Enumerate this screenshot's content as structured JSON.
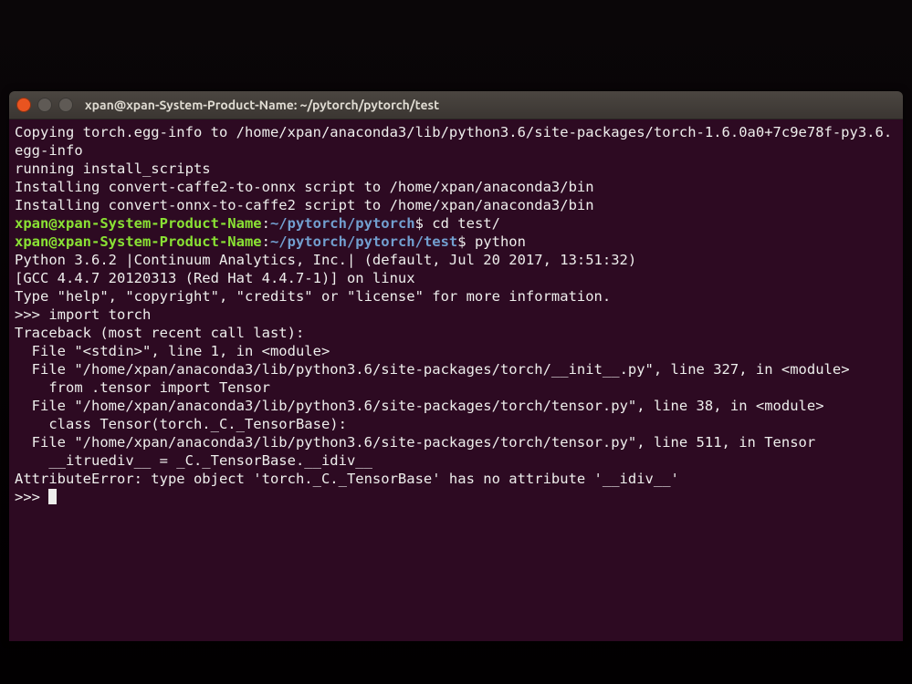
{
  "window": {
    "title": "xpan@xpan-System-Product-Name: ~/pytorch/pytorch/test"
  },
  "colors": {
    "user": "#8ae234",
    "path": "#729fcf",
    "fg": "#eeeeec",
    "bg": "#2d0a22"
  },
  "prompt1": {
    "user": "xpan@xpan-System-Product-Name",
    "sep": ":",
    "path": "~/pytorch/pytorch",
    "dollar": "$ ",
    "cmd": "cd test/"
  },
  "prompt2": {
    "user": "xpan@xpan-System-Product-Name",
    "sep": ":",
    "path": "~/pytorch/pytorch/test",
    "dollar": "$ ",
    "cmd": "python"
  },
  "lines": {
    "l1": "Copying torch.egg-info to /home/xpan/anaconda3/lib/python3.6/site-packages/torch-1.6.0a0+7c9e78f-py3.6.egg-info",
    "l2": "running install_scripts",
    "l3": "Installing convert-caffe2-to-onnx script to /home/xpan/anaconda3/bin",
    "l4": "Installing convert-onnx-to-caffe2 script to /home/xpan/anaconda3/bin",
    "py1": "Python 3.6.2 |Continuum Analytics, Inc.| (default, Jul 20 2017, 13:51:32) ",
    "py2": "[GCC 4.4.7 20120313 (Red Hat 4.4.7-1)] on linux",
    "py3": "Type \"help\", \"copyright\", \"credits\" or \"license\" for more information.",
    "imp": ">>> import torch",
    "tb0": "Traceback (most recent call last):",
    "tb1": "  File \"<stdin>\", line 1, in <module>",
    "tb2": "  File \"/home/xpan/anaconda3/lib/python3.6/site-packages/torch/__init__.py\", line 327, in <module>",
    "tb3": "    from .tensor import Tensor",
    "tb4": "  File \"/home/xpan/anaconda3/lib/python3.6/site-packages/torch/tensor.py\", line 38, in <module>",
    "tb5": "    class Tensor(torch._C._TensorBase):",
    "tb6": "  File \"/home/xpan/anaconda3/lib/python3.6/site-packages/torch/tensor.py\", line 511, in Tensor",
    "tb7": "    __itruediv__ = _C._TensorBase.__idiv__",
    "err": "AttributeError: type object 'torch._C._TensorBase' has no attribute '__idiv__'",
    "prompt3": ">>> "
  }
}
